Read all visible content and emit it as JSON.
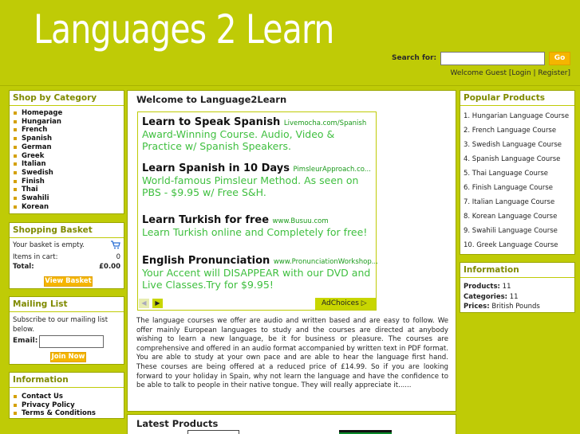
{
  "header": {
    "logo": "Languages 2 Learn",
    "search_label": "Search for:",
    "search_value": "",
    "go_label": "Go",
    "welcome_prefix": "Welcome Guest [",
    "login_label": "Login",
    "separator": " | ",
    "register_label": "Register",
    "welcome_suffix": "]"
  },
  "category": {
    "title": "Shop by Category",
    "items": [
      "Homepage",
      "Hungarian",
      "French",
      "Spanish",
      "German",
      "Greek",
      "Italian",
      "Swedish",
      "Finish",
      "Thai",
      "Swahili",
      "Korean"
    ]
  },
  "basket": {
    "title": "Shopping Basket",
    "empty_text": "Your basket is empty.",
    "items_label": "Items in cart:",
    "items_value": "0",
    "total_label": "Total:",
    "total_value": "£0.00",
    "view_button": "View Basket"
  },
  "mailing": {
    "title": "Mailing List",
    "text": "Subscribe to our mailing list below.",
    "email_label": "Email:",
    "email_value": "",
    "join_button": "Join Now"
  },
  "info_left": {
    "title": "Information",
    "items": [
      "Contact Us",
      "Privacy Policy",
      "Terms & Conditions"
    ]
  },
  "main": {
    "title": "Welcome to Language2Learn",
    "ads": [
      {
        "headline": "Learn to Speak Spanish",
        "url": "Livemocha.com/Spanish",
        "body": "Award-Winning Course. Audio, Video & Practice w/ Spanish Speakers."
      },
      {
        "headline": "Learn Spanish in 10 Days",
        "url": "PimsleurApproach.co...",
        "body": "World-famous Pimsleur Method. As seen on PBS - $9.95 w/ Free S&H."
      },
      {
        "headline": "Learn Turkish for free",
        "url": "www.Busuu.com",
        "body": "Learn Turkish online and Completely for free!"
      },
      {
        "headline": "English Pronunciation",
        "url": "www.PronunciationWorkshop...",
        "body": "Your Accent will DISAPPEAR with our DVD and Live Classes.Try for $9.95!"
      }
    ],
    "adchoices": "AdChoices",
    "paragraph": "The language courses we offer are audio and written based and are easy to follow. We offer mainly European languages to study and the courses are directed at anybody wishing to learn a new language, be it for business or pleasure. The courses are comprehensive and offered in an audio format accompanied by written text in PDF format. You are able to study at your own pace and are able to hear the language first hand. These courses are being offered at a reduced price of £14.99. So if you are looking forward to your holiday in Spain, why not learn the language and have the confidence to be able to talk to people in their native tongue. They will really appreciate it......",
    "latest_title": "Latest Products"
  },
  "popular": {
    "title": "Popular Products",
    "items": [
      "1. Hungarian Language Course",
      "2. French Language Course",
      "3. Swedish Language Course",
      "4. Spanish Language Course",
      "5. Thai Language Course",
      "6. Finish Language Course",
      "7. Italian Language Course",
      "8. Korean Language Course",
      "9. Swahili Language Course",
      "10. Greek Language Course"
    ]
  },
  "info_right": {
    "title": "Information",
    "products_label": "Products:",
    "products_value": "11",
    "categories_label": "Categories:",
    "categories_value": "11",
    "prices_label": "Prices:",
    "prices_value": "British Pounds"
  },
  "colors": {
    "background": "#bfcb06",
    "button": "#f5b500",
    "title": "#7f8a00",
    "ad_body": "#3fbf3f"
  }
}
